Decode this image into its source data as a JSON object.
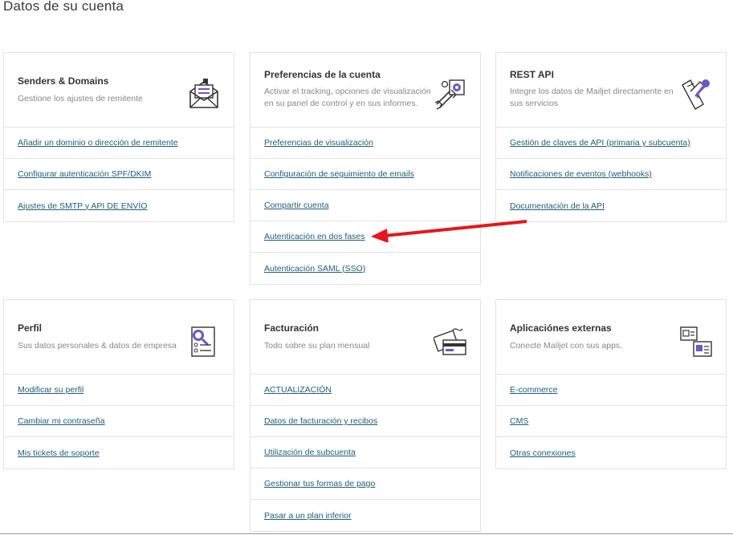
{
  "page_title": "Datos de su cuenta",
  "cards": {
    "senders": {
      "title": "Senders & Domains",
      "desc": "Gestione los ajustes de remitente",
      "links": [
        "Añadir un dominio o dirección de remitente",
        "Configurar autenticación SPF/DKIM",
        "Ajustes de SMTP y API DE ENVÍO"
      ]
    },
    "prefs": {
      "title": "Preferencias de la cuenta",
      "desc": "Activar el tracking, opciones de visualización en su panel de control y en sus informes.",
      "links": [
        "Preferencias de visualización",
        "Configuración de seguimiento de emails",
        "Compartir cuenta",
        "Autenticación en dos fases",
        "Autenticación SAML (SSO)"
      ]
    },
    "rest": {
      "title": "REST API",
      "desc": "Integre los datos de Mailjet directamente en sus servicios",
      "links": [
        "Gestión de claves de API (primaria y subcuenta)",
        "Notificaciones de eventos (webhooks)",
        "Documentación de la API"
      ]
    },
    "perfil": {
      "title": "Perfil",
      "desc": "Sus datos personales & datos de empresa",
      "links": [
        "Modificar su perfil",
        "Cambiar mi contraseña",
        "Mis tickets de soporte"
      ]
    },
    "billing": {
      "title": "Facturación",
      "desc": "Todo sobre su plan mensual",
      "links": [
        "ACTUALIZACIÓN",
        "Datos de facturación y recibos",
        "Utilización de subcuenta",
        "Gestionar tus formas de pago",
        "Pasar a un plan inferior"
      ]
    },
    "apps": {
      "title": "Aplicaciónes externas",
      "desc": "Conecte Mailjet con sus apps.",
      "links": [
        "E-commerce",
        "CMS",
        "Otras conexiones"
      ]
    }
  },
  "icons": {
    "senders": "envelope-icon",
    "prefs": "settings-wrench-icon",
    "rest": "api-keys-icon",
    "perfil": "profile-search-icon",
    "billing": "billing-card-icon",
    "apps": "external-apps-icon"
  },
  "colors": {
    "link": "#1f5d79",
    "accent": "#6a58c6",
    "annotation": "#e8161b"
  }
}
